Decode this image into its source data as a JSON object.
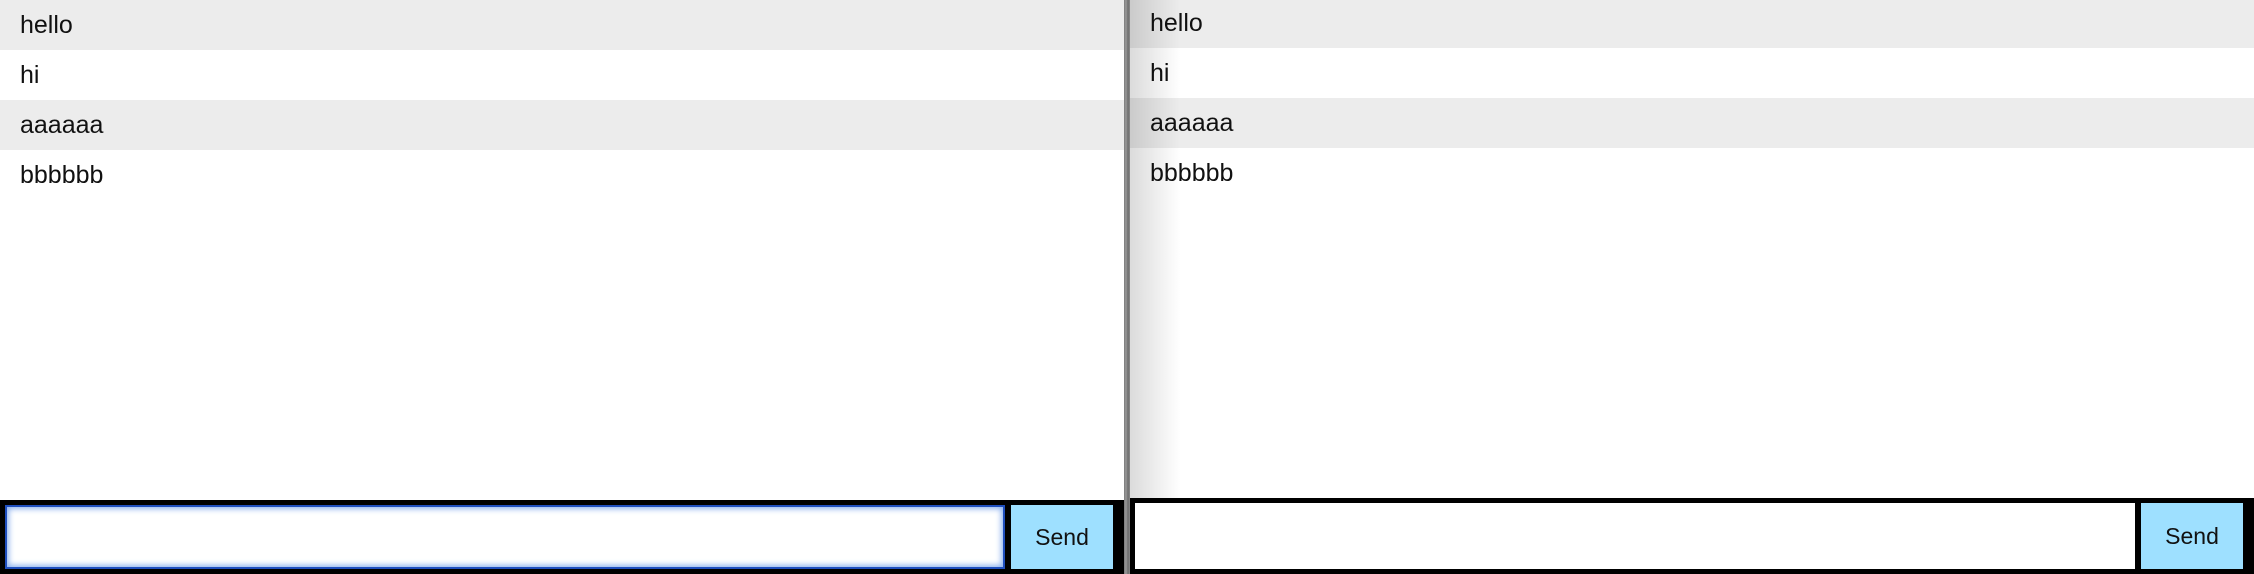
{
  "left_pane": {
    "messages": [
      "hello",
      "hi",
      "aaaaaa",
      "bbbbbb"
    ],
    "input": {
      "value": "",
      "placeholder": ""
    },
    "send_label": "Send"
  },
  "right_pane": {
    "messages": [
      "hello",
      "hi",
      "aaaaaa",
      "bbbbbb"
    ],
    "input": {
      "value": "",
      "placeholder": ""
    },
    "send_label": "Send"
  },
  "colors": {
    "send_button_bg": "#9ee0ff",
    "alt_row_bg": "#ececec",
    "composer_bg": "#000000",
    "focus_ring": "#1f4fbf"
  }
}
